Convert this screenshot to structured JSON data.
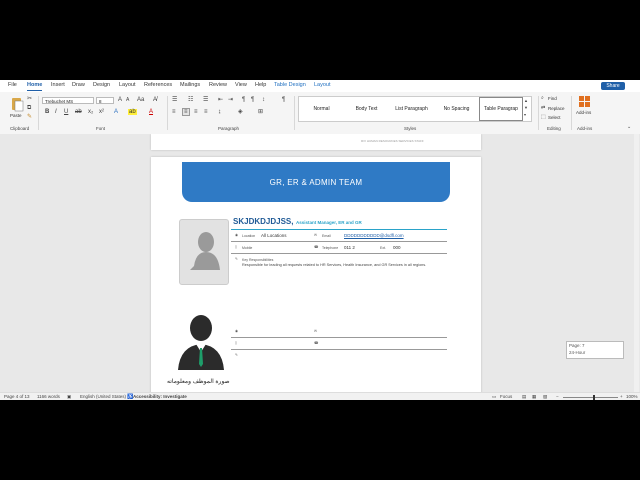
{
  "menu": {
    "items": [
      "File",
      "Home",
      "Insert",
      "Draw",
      "Design",
      "Layout",
      "References",
      "Mailings",
      "Review",
      "View",
      "Help"
    ],
    "context_tabs": [
      "Table Design",
      "Layout"
    ],
    "share_label": "Share"
  },
  "ribbon": {
    "font_name": "Trebuchet MS",
    "font_size": "8",
    "paste_label": "Paste",
    "groups": {
      "clipboard": "Clipboard",
      "font": "Font",
      "paragraph": "Paragraph",
      "styles": "Styles",
      "editing": "Editing",
      "addins": "Add-ins"
    },
    "styles": [
      "Normal",
      "Body Text",
      "List Paragraph",
      "No Spacing",
      "Table Paragrap"
    ],
    "editing": {
      "find": "Find",
      "replace": "Replace",
      "select": "Select"
    },
    "addins_label": "Add-ins"
  },
  "document": {
    "header_note": "R/V HUMAN RESOURCES SERVICES STAFF",
    "banner_title": "GR, ER & ADMIN TEAM",
    "person": {
      "name": "SKJDKDJDJSS,",
      "title": "Assistant Manager, ER and GR",
      "location_label": "Location",
      "location_value": "All Locations",
      "email_label": "Email",
      "email_value": "DDDDDDDDDDD@dsdfl.com",
      "mobile_label": "Mobile",
      "telephone_label": "Telephone",
      "telephone_value": "011 2",
      "ext_label": "Ext.",
      "ext_value": "000",
      "key_resp_label": "Key Responsibilities",
      "key_resp_text": "Responsible for leading all requests related to HR Services, Health Insurance, and GR Services in all regions."
    },
    "arabic_caption": "صورة الموظف ومعلوماته"
  },
  "tooltip": {
    "line1": "Page: 7",
    "line2": "24-Hour"
  },
  "status": {
    "page": "Page 4 of 13",
    "words": "1166 words",
    "language": "English (United States)",
    "accessibility": "Accessibility: Investigate",
    "focus": "Focus",
    "zoom": "100%"
  },
  "colors": {
    "accent": "#1f5fa8",
    "banner": "#2f7ac5",
    "name": "#1f5a96",
    "title": "#2aa3c9"
  }
}
